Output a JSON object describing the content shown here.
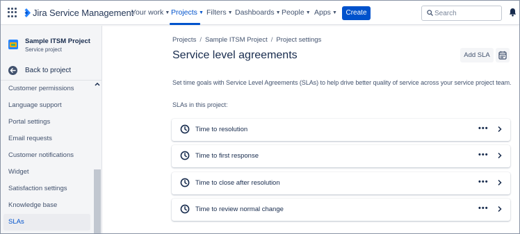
{
  "app": {
    "name": "Jira Service Management"
  },
  "nav": {
    "items": [
      {
        "label": "Your work"
      },
      {
        "label": "Projects"
      },
      {
        "label": "Filters"
      },
      {
        "label": "Dashboards"
      },
      {
        "label": "People"
      },
      {
        "label": "Apps"
      }
    ],
    "active": "Projects",
    "create_label": "Create",
    "search_placeholder": "Search",
    "search_value": ""
  },
  "icons": {
    "app_switcher": "grid-icon",
    "logo": "jira-logo-icon",
    "search": "search-icon",
    "notifications": "bell-icon",
    "back": "arrow-left-icon",
    "sla_item": "clock-icon",
    "more": "more-horizontal-icon",
    "open": "chevron-right-icon",
    "calendar": "calendar-icon"
  },
  "sidebar": {
    "project_name": "Sample ITSM Project",
    "project_type": "Service project",
    "back_label": "Back to project",
    "items": [
      {
        "label": "Customer permissions"
      },
      {
        "label": "Language support"
      },
      {
        "label": "Portal settings"
      },
      {
        "label": "Email requests"
      },
      {
        "label": "Customer notifications"
      },
      {
        "label": "Widget"
      },
      {
        "label": "Satisfaction settings"
      },
      {
        "label": "Knowledge base"
      },
      {
        "label": "SLAs"
      }
    ],
    "selected": "SLAs"
  },
  "breadcrumbs": [
    "Projects",
    "Sample ITSM Project",
    "Project settings"
  ],
  "page": {
    "title": "Service level agreements",
    "add_sla_label": "Add SLA",
    "description": "Set time goals with Service Level Agreements (SLAs) to help drive better quality of service across your service project team.",
    "list_label": "SLAs in this project:",
    "slas": [
      {
        "name": "Time to resolution"
      },
      {
        "name": "Time to first response"
      },
      {
        "name": "Time to close after resolution"
      },
      {
        "name": "Time to review normal change"
      }
    ],
    "more_glyph": "•••"
  },
  "colors": {
    "brand": "#0052cc",
    "text": "#172b4d",
    "subtle_text": "#42526e",
    "sidebar_bg": "#f4f5f7"
  }
}
